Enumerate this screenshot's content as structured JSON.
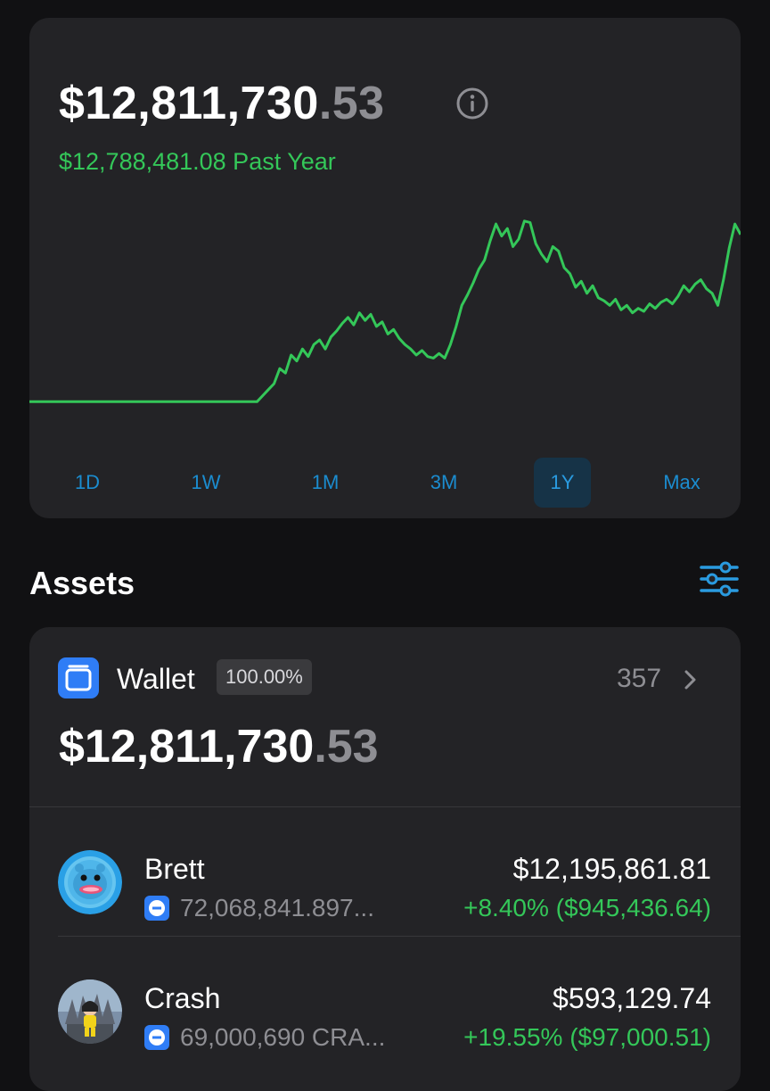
{
  "portfolio": {
    "balance_main": "$12,811,730",
    "balance_cents": ".53",
    "change_text": "$12,788,481.08 Past Year",
    "accent_color": "#34c759"
  },
  "time_ranges": [
    {
      "label": "1D",
      "active": false
    },
    {
      "label": "1W",
      "active": false
    },
    {
      "label": "1M",
      "active": false
    },
    {
      "label": "3M",
      "active": false
    },
    {
      "label": "1Y",
      "active": true
    },
    {
      "label": "Max",
      "active": false
    }
  ],
  "chart_data": {
    "type": "line",
    "series": [
      {
        "values": [
          0.1,
          0.1,
          0.1,
          0.1,
          0.1,
          0.1,
          0.1,
          0.1,
          0.1,
          0.1,
          0.1,
          0.1,
          0.1,
          0.1,
          0.1,
          0.1,
          0.1,
          0.1,
          0.1,
          0.1,
          0.1,
          0.1,
          0.1,
          0.1,
          0.1,
          0.1,
          0.1,
          0.1,
          0.1,
          0.1,
          0.1,
          0.1,
          0.1,
          0.1,
          0.1,
          0.1,
          0.1,
          0.1,
          0.1,
          0.1,
          0.1,
          0.5,
          0.9,
          1.3,
          2.3,
          2.0,
          3.2,
          2.8,
          3.6,
          3.1,
          3.9,
          4.2,
          3.6,
          4.4,
          4.8,
          5.3,
          5.7,
          5.2,
          6.0,
          5.5,
          5.9,
          5.1,
          5.4,
          4.6,
          4.9,
          4.3,
          3.9,
          3.6,
          3.2,
          3.5,
          3.1,
          3.0,
          3.3,
          3.0,
          3.9,
          5.1,
          6.5,
          7.2,
          8.0,
          8.9,
          9.5,
          10.8,
          11.9,
          11.1,
          11.6,
          10.4,
          10.9,
          12.1,
          12.0,
          10.6,
          9.9,
          9.4,
          10.4,
          10.1,
          9.0,
          8.6,
          7.7,
          8.1,
          7.3,
          7.8,
          7.0,
          6.8,
          6.5,
          6.9,
          6.2,
          6.5,
          6.0,
          6.3,
          6.1,
          6.6,
          6.3,
          6.7,
          6.9,
          6.6,
          7.1,
          7.8,
          7.4,
          7.9,
          8.2,
          7.6,
          7.3,
          6.5,
          8.2,
          10.3,
          11.9,
          11.2
        ]
      }
    ],
    "x_range": [
      0,
      127
    ],
    "ylim": [
      0,
      12.5
    ],
    "grid": false,
    "color": "#34c759"
  },
  "assets": {
    "title": "Assets",
    "filter_icon": "sliders-icon"
  },
  "wallet": {
    "label": "Wallet",
    "percent": "100.00%",
    "count": "357",
    "balance_main": "$12,811,730",
    "balance_cents": ".53",
    "icon": "wallet-icon",
    "icon_color": "#2f7df6"
  },
  "tokens": [
    {
      "name": "Brett",
      "holding": "72,068,841.897...",
      "value": "$12,195,861.81",
      "delta": "+8.40% ($945,436.64)",
      "avatar_icon": "brett-avatar-icon"
    },
    {
      "name": "Crash",
      "holding": "69,000,690 CRA...",
      "value": "$593,129.74",
      "delta": "+19.55% ($97,000.51)",
      "avatar_icon": "crash-avatar-icon"
    }
  ]
}
